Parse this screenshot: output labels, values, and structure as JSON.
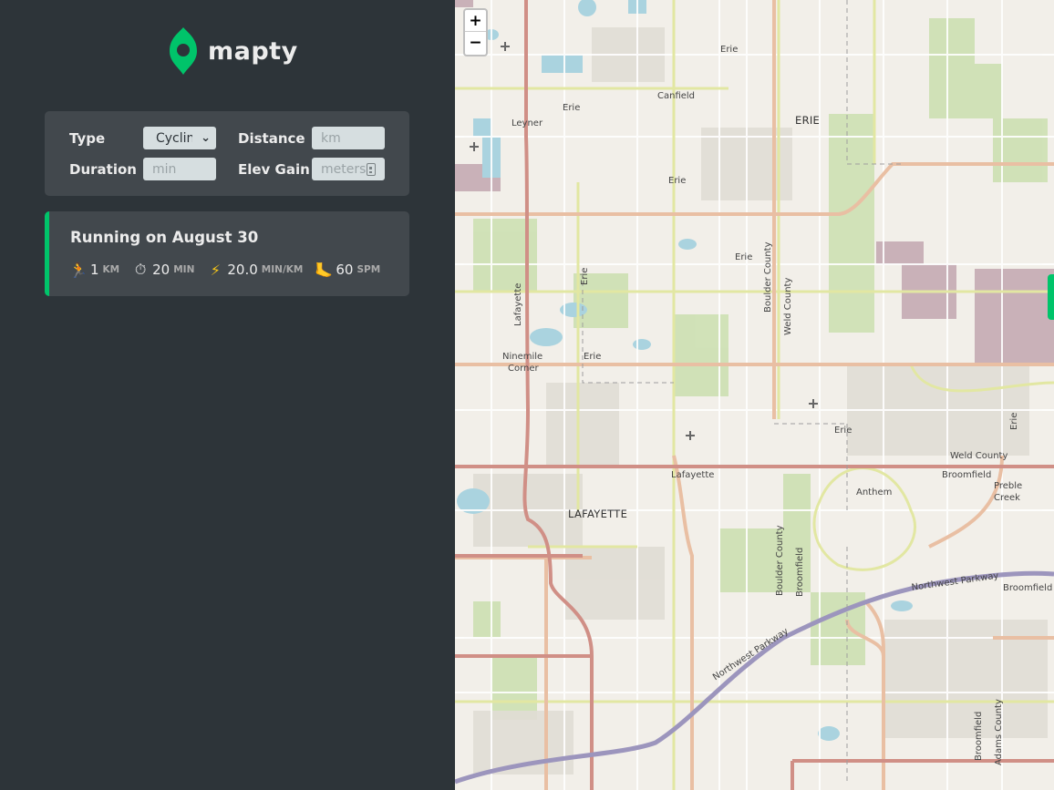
{
  "app": {
    "name": "mapty",
    "accent": "#00c46a",
    "sidebar_bg": "#2d3439",
    "card_bg": "#42484d"
  },
  "form": {
    "type_label": "Type",
    "type_value": "Cycling",
    "distance_label": "Distance",
    "distance_placeholder": "km",
    "duration_label": "Duration",
    "duration_placeholder": "min",
    "elev_label": "Elev Gain",
    "elev_placeholder": "meters"
  },
  "workouts": [
    {
      "title": "Running on August 30",
      "distance": "1",
      "distance_unit": "km",
      "duration": "20",
      "duration_unit": "min",
      "pace": "20.0",
      "pace_unit": "min/km",
      "cadence": "60",
      "cadence_unit": "spm",
      "icons": [
        "running-icon",
        "stopwatch-icon",
        "lightning-icon",
        "foot-icon"
      ]
    }
  ],
  "map": {
    "zoom_in": "+",
    "zoom_out": "−",
    "labels": {
      "erie1": "Erie",
      "canfield": "Canfield",
      "leyner": "Leyner",
      "erie2": "Erie",
      "erie_town": "ERIE",
      "erie3": "Erie",
      "erie4": "Erie",
      "erie5": "Erie",
      "lafayette_road": "Lafayette",
      "boulder_county1": "Boulder County",
      "weld_county1": "Weld County",
      "ninemile": "Ninemile",
      "corner": "Corner",
      "erie6": "Erie",
      "erie7": "Erie",
      "erie8": "Erie",
      "weld_county2": "Weld County",
      "lafayette_label": "Lafayette",
      "broomfield1": "Broomfield",
      "anthem": "Anthem",
      "preble": "Preble",
      "creek": "Creek",
      "lafayette_town": "LAFAYETTE",
      "boulder_county2": "Boulder County",
      "broomfield2": "Broomfield",
      "northwest_parkway1": "Northwest Parkway",
      "broomfield3": "Broomfield",
      "northwest_parkway2": "Northwest Parkway",
      "broomfield4": "Broomfield",
      "adams_county": "Adams County"
    }
  }
}
